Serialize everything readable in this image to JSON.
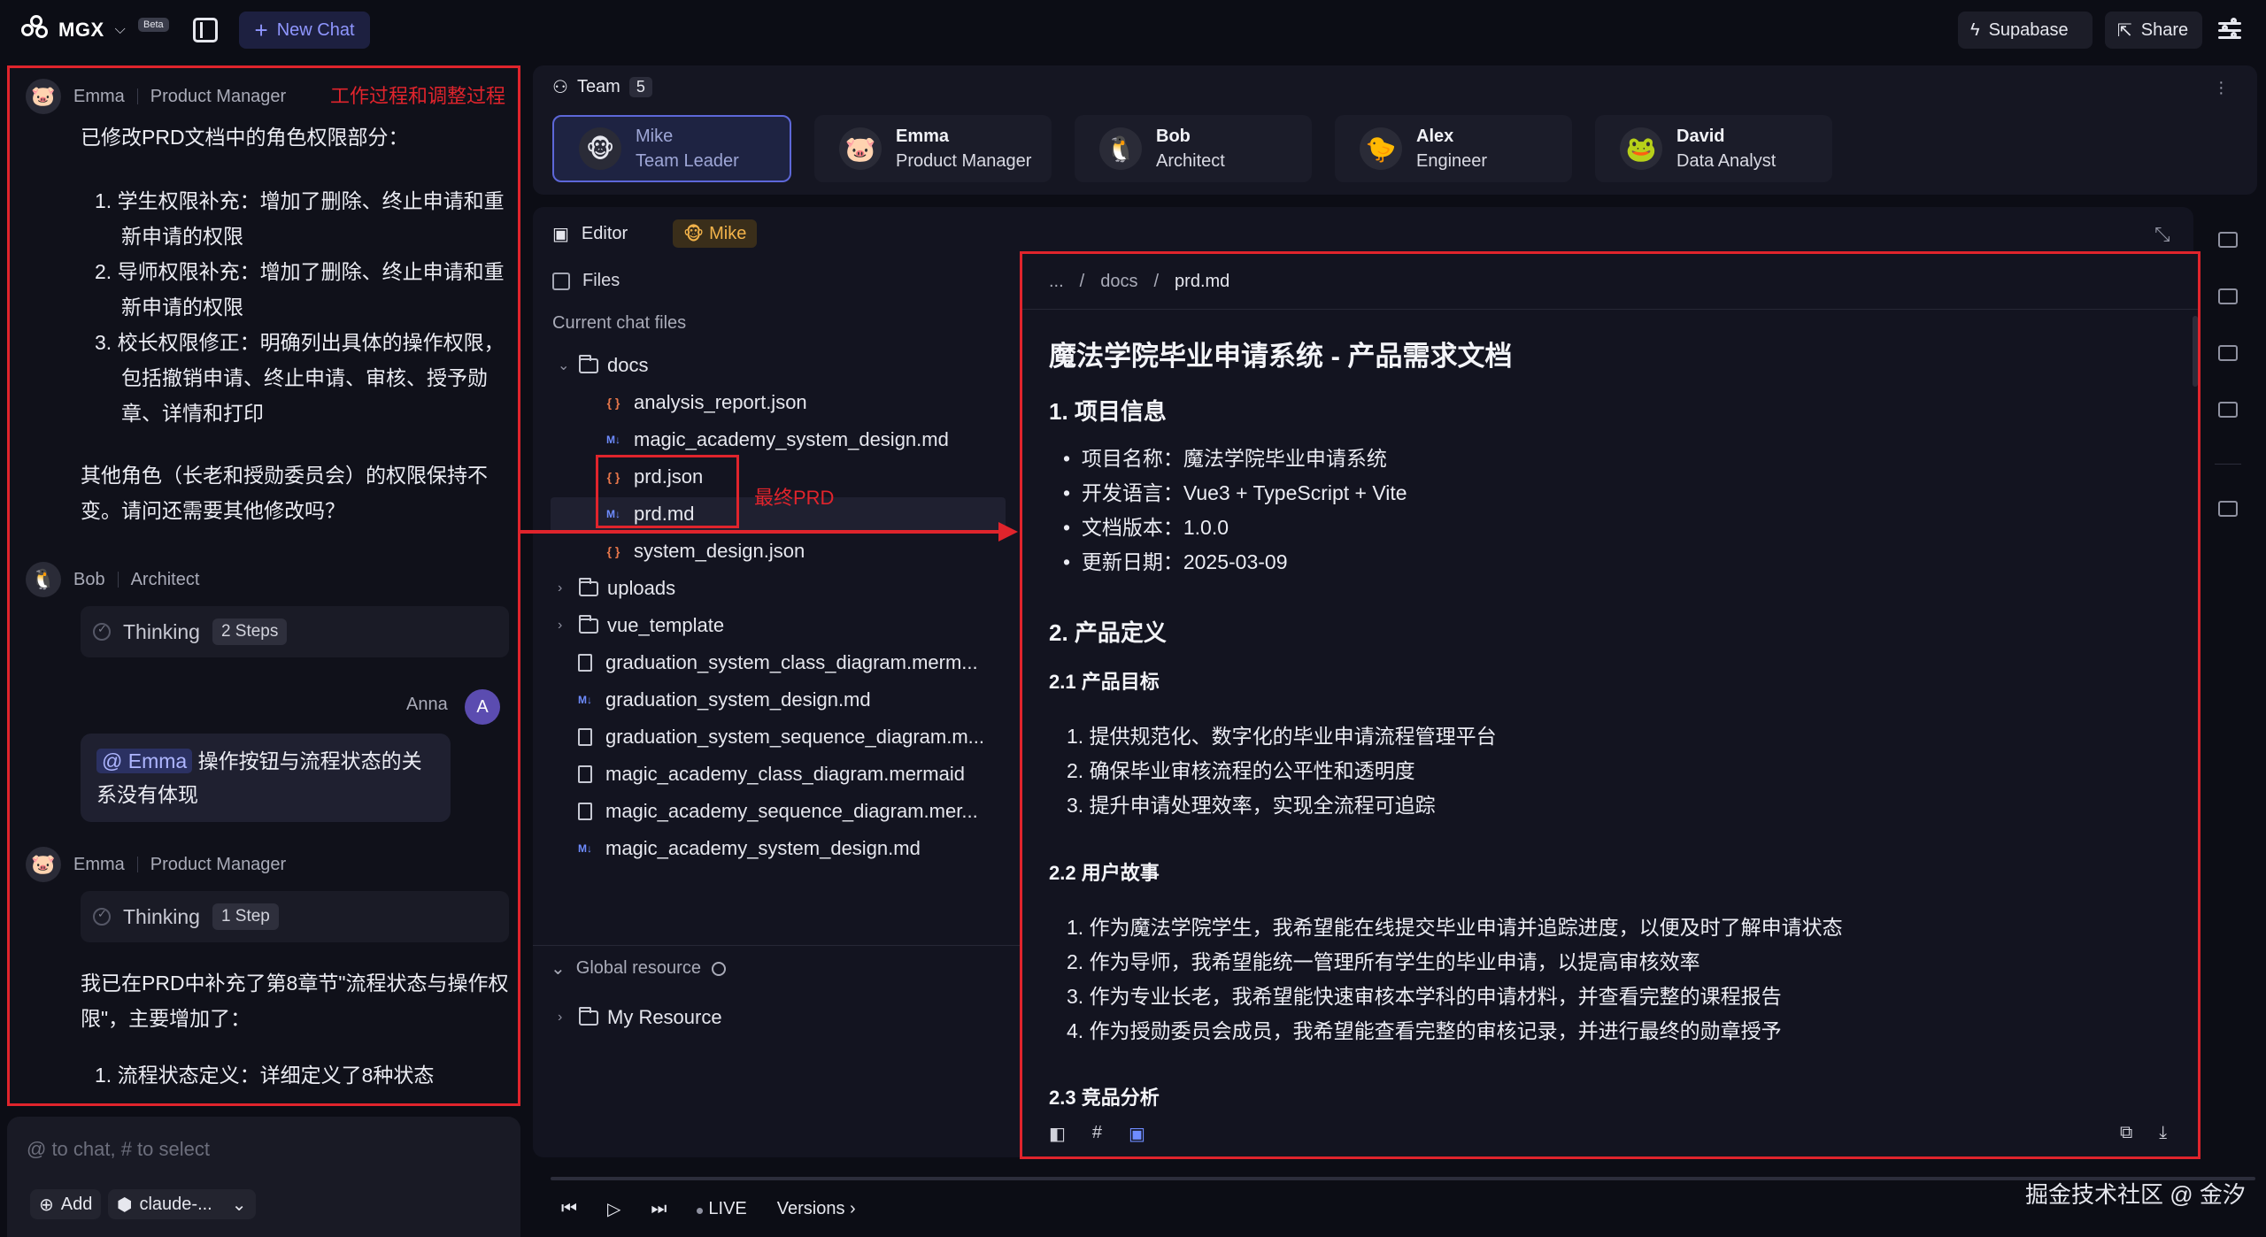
{
  "topbar": {
    "logo_text": "MGX",
    "logo_caret": "⌵",
    "beta": "Beta",
    "new_chat": "New Chat",
    "supabase": "Supabase",
    "share": "Share"
  },
  "chat": {
    "note": "工作过程和调整过程",
    "messages": [
      {
        "author": "Emma",
        "role": "Product Manager",
        "intro": "已修改PRD文档中的角色权限部分：",
        "items": [
          "学生权限补充：增加了删除、终止申请和重",
          "新申请的权限",
          "导师权限补充：增加了删除、终止申请和重",
          "新申请的权限",
          "校长权限修正：明确列出具体的操作权限，",
          "包括撤销申请、终止申请、审核、授予勋",
          "章、详情和打印"
        ],
        "outro_1": "其他角色（长老和授勋委员会）的权限保持不",
        "outro_2": "变。请问还需要其他修改吗？"
      }
    ],
    "bob": {
      "author": "Bob",
      "role": "Architect",
      "thinking": "Thinking",
      "steps": "2 Steps"
    },
    "anna": {
      "name": "Anna",
      "initial": "A",
      "mention": "@ Emma",
      "text_1": " 操作按钮与流程状态的关",
      "text_2": "系没有体现"
    },
    "emma2": {
      "author": "Emma",
      "role": "Product Manager",
      "thinking": "Thinking",
      "steps": "1 Step",
      "text_1": "我已在PRD中补充了第8章节\"流程状态与操作权",
      "text_2": "限\"，主要增加了：",
      "item_1": "流程状态定义：详细定义了8种状态"
    }
  },
  "chat_input": {
    "placeholder": "@ to chat, # to select",
    "add": "Add",
    "model": "claude-..."
  },
  "team": {
    "title": "Team",
    "count": "5",
    "members": [
      {
        "name": "Mike",
        "role": "Team Leader",
        "icon": "🐵"
      },
      {
        "name": "Emma",
        "role": "Product Manager",
        "icon": "🐷"
      },
      {
        "name": "Bob",
        "role": "Architect",
        "icon": "🐧"
      },
      {
        "name": "Alex",
        "role": "Engineer",
        "icon": "🐤"
      },
      {
        "name": "David",
        "role": "Data Analyst",
        "icon": "🐸"
      }
    ]
  },
  "editor": {
    "tab": "Editor",
    "agent": "Mike",
    "files_label": "Files",
    "current_chat_files": "Current chat files",
    "tree": [
      {
        "name": "docs",
        "type": "folder",
        "open": true
      },
      {
        "name": "analysis_report.json",
        "type": "json"
      },
      {
        "name": "magic_academy_system_design.md",
        "type": "md"
      },
      {
        "name": "prd.json",
        "type": "json"
      },
      {
        "name": "prd.md",
        "type": "md"
      },
      {
        "name": "system_design.json",
        "type": "json"
      },
      {
        "name": "uploads",
        "type": "folder"
      },
      {
        "name": "vue_template",
        "type": "folder"
      },
      {
        "name": "graduation_system_class_diagram.merm...",
        "type": "doc"
      },
      {
        "name": "graduation_system_design.md",
        "type": "md"
      },
      {
        "name": "graduation_system_sequence_diagram.m...",
        "type": "doc"
      },
      {
        "name": "magic_academy_class_diagram.mermaid",
        "type": "doc"
      },
      {
        "name": "magic_academy_sequence_diagram.mer...",
        "type": "doc"
      },
      {
        "name": "magic_academy_system_design.md",
        "type": "md"
      }
    ],
    "final_prd_note": "最终PRD",
    "global_resource": "Global resource",
    "my_resource": "My Resource"
  },
  "doc": {
    "breadcrumb": [
      "...",
      "/",
      "docs",
      "/",
      "prd.md"
    ],
    "title": "魔法学院毕业申请系统 - 产品需求文档",
    "s1": "1. 项目信息",
    "s1_items": [
      "项目名称：魔法学院毕业申请系统",
      "开发语言：Vue3 + TypeScript + Vite",
      "文档版本：1.0.0",
      "更新日期：2025-03-09"
    ],
    "s2": "2. 产品定义",
    "s21": "2.1 产品目标",
    "s21_items": [
      "1. 提供规范化、数字化的毕业申请流程管理平台",
      "2. 确保毕业审核流程的公平性和透明度",
      "3. 提升申请处理效率，实现全流程可追踪"
    ],
    "s22": "2.2 用户故事",
    "s22_items": [
      "1. 作为魔法学院学生，我希望能在线提交毕业申请并追踪进度，以便及时了解申请状态",
      "2. 作为导师，我希望能统一管理所有学生的毕业申请，以提高审核效率",
      "3. 作为专业长老，我希望能快速审核本学科的申请材料，并查看完整的课程报告",
      "4. 作为授勋委员会成员，我希望能查看完整的审核记录，并进行最终的勋章授予"
    ],
    "s23": "2.3 竞品分析"
  },
  "playback": {
    "live": "LIVE",
    "versions": "Versions"
  },
  "watermark": "掘金技术社区 @ 金汐"
}
